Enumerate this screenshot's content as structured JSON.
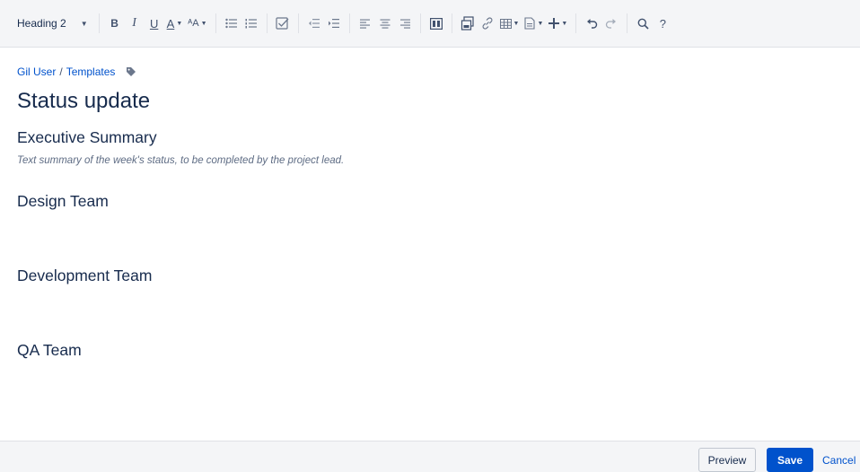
{
  "toolbar": {
    "style_select_label": "Heading 2",
    "bold": "B",
    "italic": "I",
    "underline": "U",
    "text_color": "A",
    "font_size": "ᴬA"
  },
  "breadcrumb": {
    "parent": "Gil User",
    "separator": "/",
    "current": "Templates"
  },
  "page": {
    "title": "Status update",
    "sections": {
      "executive_summary": "Executive Summary",
      "instruction": "Text summary of the week's status, to be completed by the project lead.",
      "design_team": "Design Team",
      "development_team": "Development Team",
      "qa_team": "QA Team"
    }
  },
  "actions": {
    "preview": "Preview",
    "save": "Save",
    "cancel": "Cancel"
  },
  "colors": {
    "accent": "#0052cc",
    "toolbar_bg": "#f4f5f7",
    "text": "#172b4d",
    "icon": "#42526e"
  }
}
